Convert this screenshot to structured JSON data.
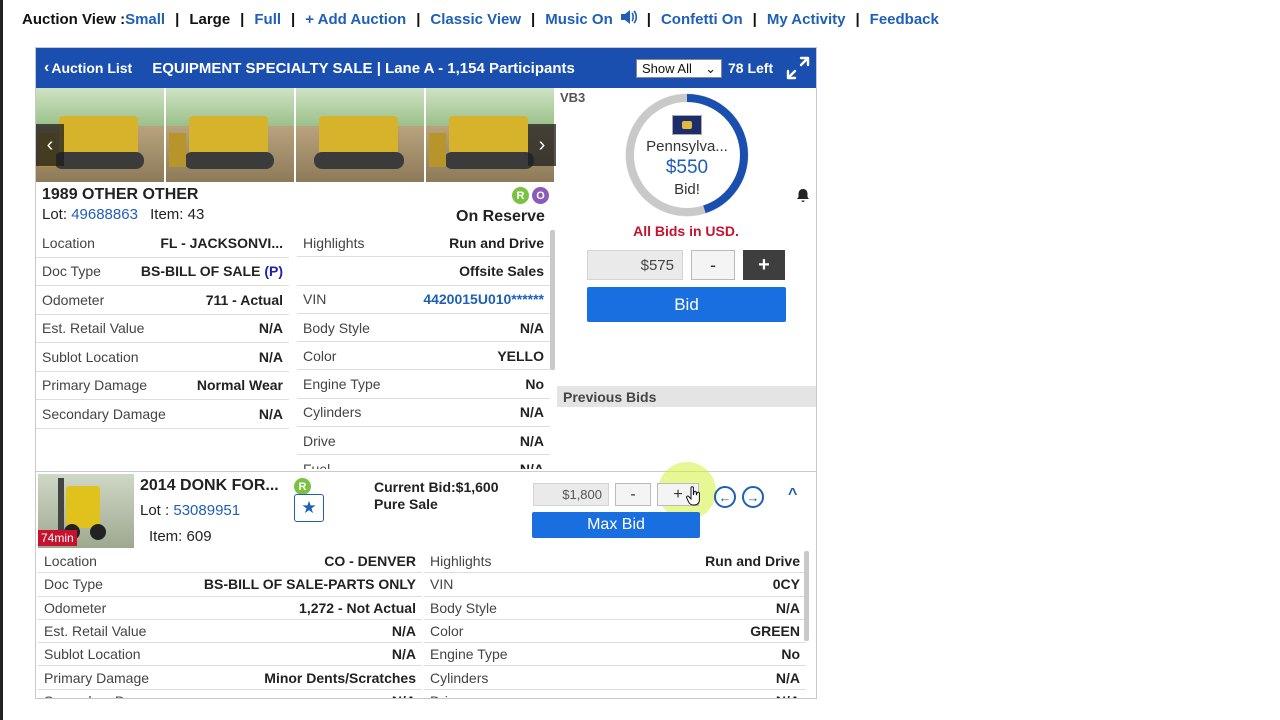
{
  "topnav": {
    "label": "Auction View : ",
    "small": "Small",
    "large": "Large",
    "full": "Full",
    "add_auction": "+ Add Auction",
    "classic_view": "Classic View",
    "music": "Music On",
    "confetti": "Confetti On",
    "activity": "My Activity",
    "feedback": "Feedback",
    "sep": "|"
  },
  "panel": {
    "back_label": "Auction List",
    "title": "EQUIPMENT SPECIALTY SALE | Lane A - 1,154 Participants",
    "filter_selected": "Show All",
    "left_count": "78 Left",
    "vb3": "VB3"
  },
  "lot1": {
    "title": "1989 OTHER OTHER",
    "lot_label": "Lot: ",
    "lot_number": "49688863",
    "item_label": "Item: ",
    "item_number": "43",
    "badge_r": "R",
    "badge_o": "O",
    "status": "On Reserve",
    "details_left": [
      {
        "k": "Location",
        "v": "FL - JACKSONVI..."
      },
      {
        "k": "Doc Type",
        "v": "BS-BILL OF SALE",
        "v2": "(P)"
      },
      {
        "k": "Odometer",
        "v": "711 - Actual"
      },
      {
        "k": "Est. Retail Value",
        "v": "N/A"
      },
      {
        "k": "Sublot Location",
        "v": "N/A"
      },
      {
        "k": "Primary Damage",
        "v": "Normal Wear"
      },
      {
        "k": "Secondary Damage",
        "v": "N/A"
      }
    ],
    "details_right": [
      {
        "k": "Highlights",
        "v": "Run and Drive"
      },
      {
        "k": "",
        "v": "Offsite Sales"
      },
      {
        "k": "VIN",
        "v": "4420015U010******"
      },
      {
        "k": "Body Style",
        "v": "N/A"
      },
      {
        "k": "Color",
        "v": "YELLO"
      },
      {
        "k": "Engine Type",
        "v": "No"
      },
      {
        "k": "Cylinders",
        "v": "N/A"
      },
      {
        "k": "Drive",
        "v": "N/A"
      },
      {
        "k": "Fuel",
        "v": "N/A"
      }
    ],
    "gauge": {
      "state": "Pennsylva...",
      "amount": "$550",
      "bid": "Bid!",
      "fill": 0.45
    },
    "all_bids": "All Bids in USD.",
    "bid_amount": "$575",
    "minus": "-",
    "plus": "+",
    "bid_button": "Bid",
    "previous_bids": "Previous Bids"
  },
  "lot2": {
    "title": "2014 DONK FOR...",
    "badge_r": "R",
    "lot_label": "Lot : ",
    "lot_number": "53089951",
    "item_label": "Item: ",
    "item_number": "609",
    "time_left": "74min",
    "current_bid": "Current Bid:$1,600",
    "sale_type": "Pure Sale",
    "bid_amount": "$1,800",
    "minus": "-",
    "plus": "+",
    "max_bid": "Max Bid",
    "details_left": [
      {
        "k": "Location",
        "v": "CO - DENVER"
      },
      {
        "k": "Doc Type",
        "v": "BS-BILL OF SALE-PARTS ONLY"
      },
      {
        "k": "Odometer",
        "v": "1,272 - Not Actual"
      },
      {
        "k": "Est. Retail Value",
        "v": "N/A"
      },
      {
        "k": "Sublot Location",
        "v": "N/A"
      },
      {
        "k": "Primary Damage",
        "v": "Minor Dents/Scratches"
      },
      {
        "k": "Secondary Damage",
        "v": "N/A"
      }
    ],
    "details_right": [
      {
        "k": "Highlights",
        "v": "Run and Drive"
      },
      {
        "k": "VIN",
        "v": "0CY"
      },
      {
        "k": "Body Style",
        "v": "N/A"
      },
      {
        "k": "Color",
        "v": "GREEN"
      },
      {
        "k": "Engine Type",
        "v": "No"
      },
      {
        "k": "Cylinders",
        "v": "N/A"
      },
      {
        "k": "Drive",
        "v": "N/A"
      }
    ]
  },
  "colors": {
    "brand_blue": "#1a4fb0",
    "button_blue": "#1a6fe0",
    "alert_red": "#c4122f",
    "badge_green": "#7cc242",
    "badge_purple": "#8a5bb8"
  }
}
